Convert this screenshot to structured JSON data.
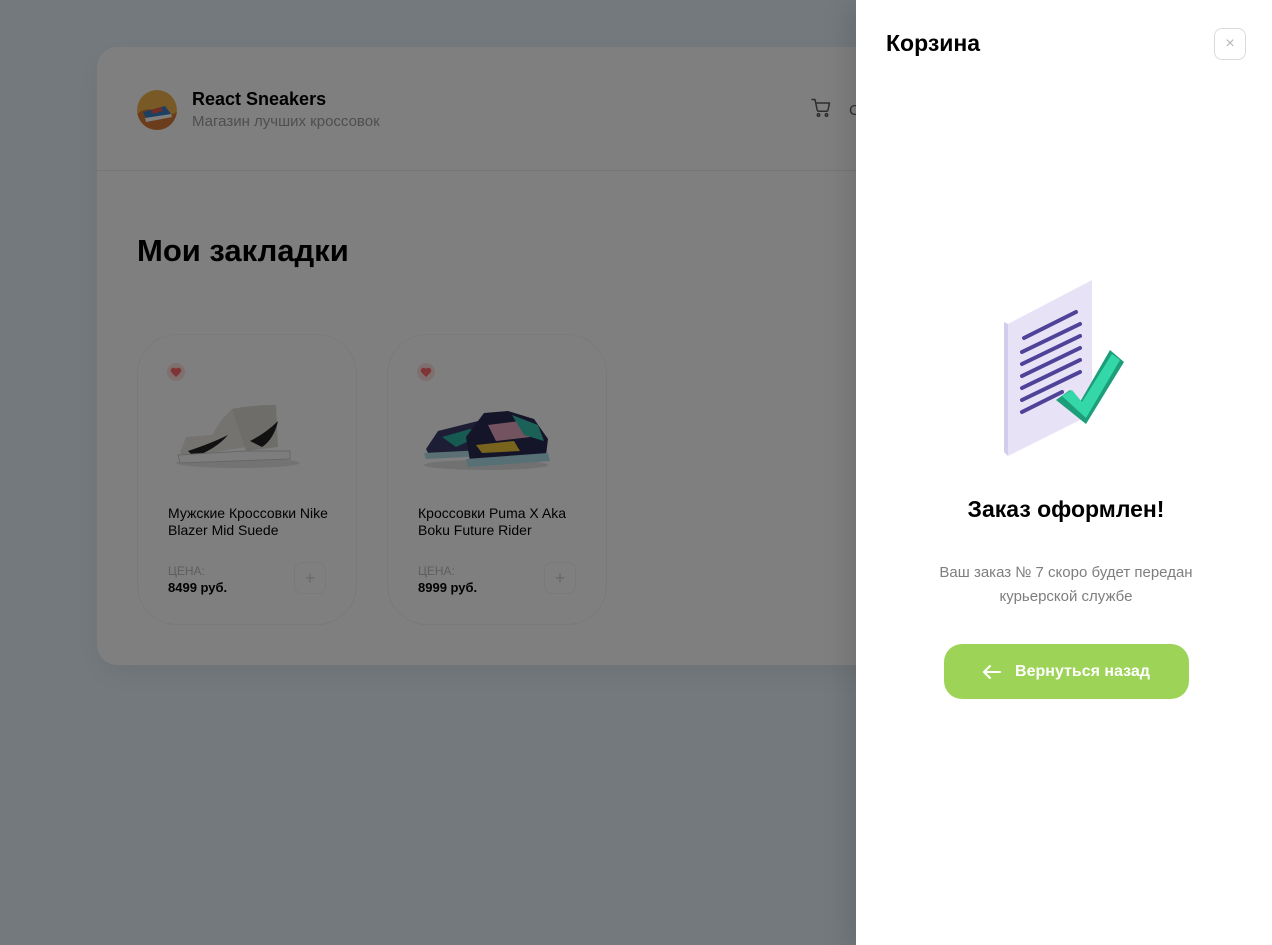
{
  "header": {
    "brand_title": "React Sneakers",
    "brand_subtitle": "Магазин лучших кроссовок",
    "cart_total": "С"
  },
  "page": {
    "heading": "Мои закладки"
  },
  "products": [
    {
      "title": "Мужские Кроссовки Nike Blazer Mid Suede",
      "price_label": "ЦЕНА:",
      "price": "8499 руб.",
      "favorite": true,
      "add_label": "+"
    },
    {
      "title": "Кроссовки Puma X Aka Boku Future Rider",
      "price_label": "ЦЕНА:",
      "price": "8999 руб.",
      "favorite": true,
      "add_label": "+"
    }
  ],
  "drawer": {
    "title": "Корзина",
    "close_label": "×",
    "success_title": "Заказ оформлен!",
    "success_text": "Ваш заказ № 7 скоро будет передан курьерской службе",
    "back_button": "Вернуться назад"
  },
  "colors": {
    "accent": "#9dd458",
    "overlay": "rgba(0,0,0,0.5)",
    "heart": "#ff8585"
  }
}
